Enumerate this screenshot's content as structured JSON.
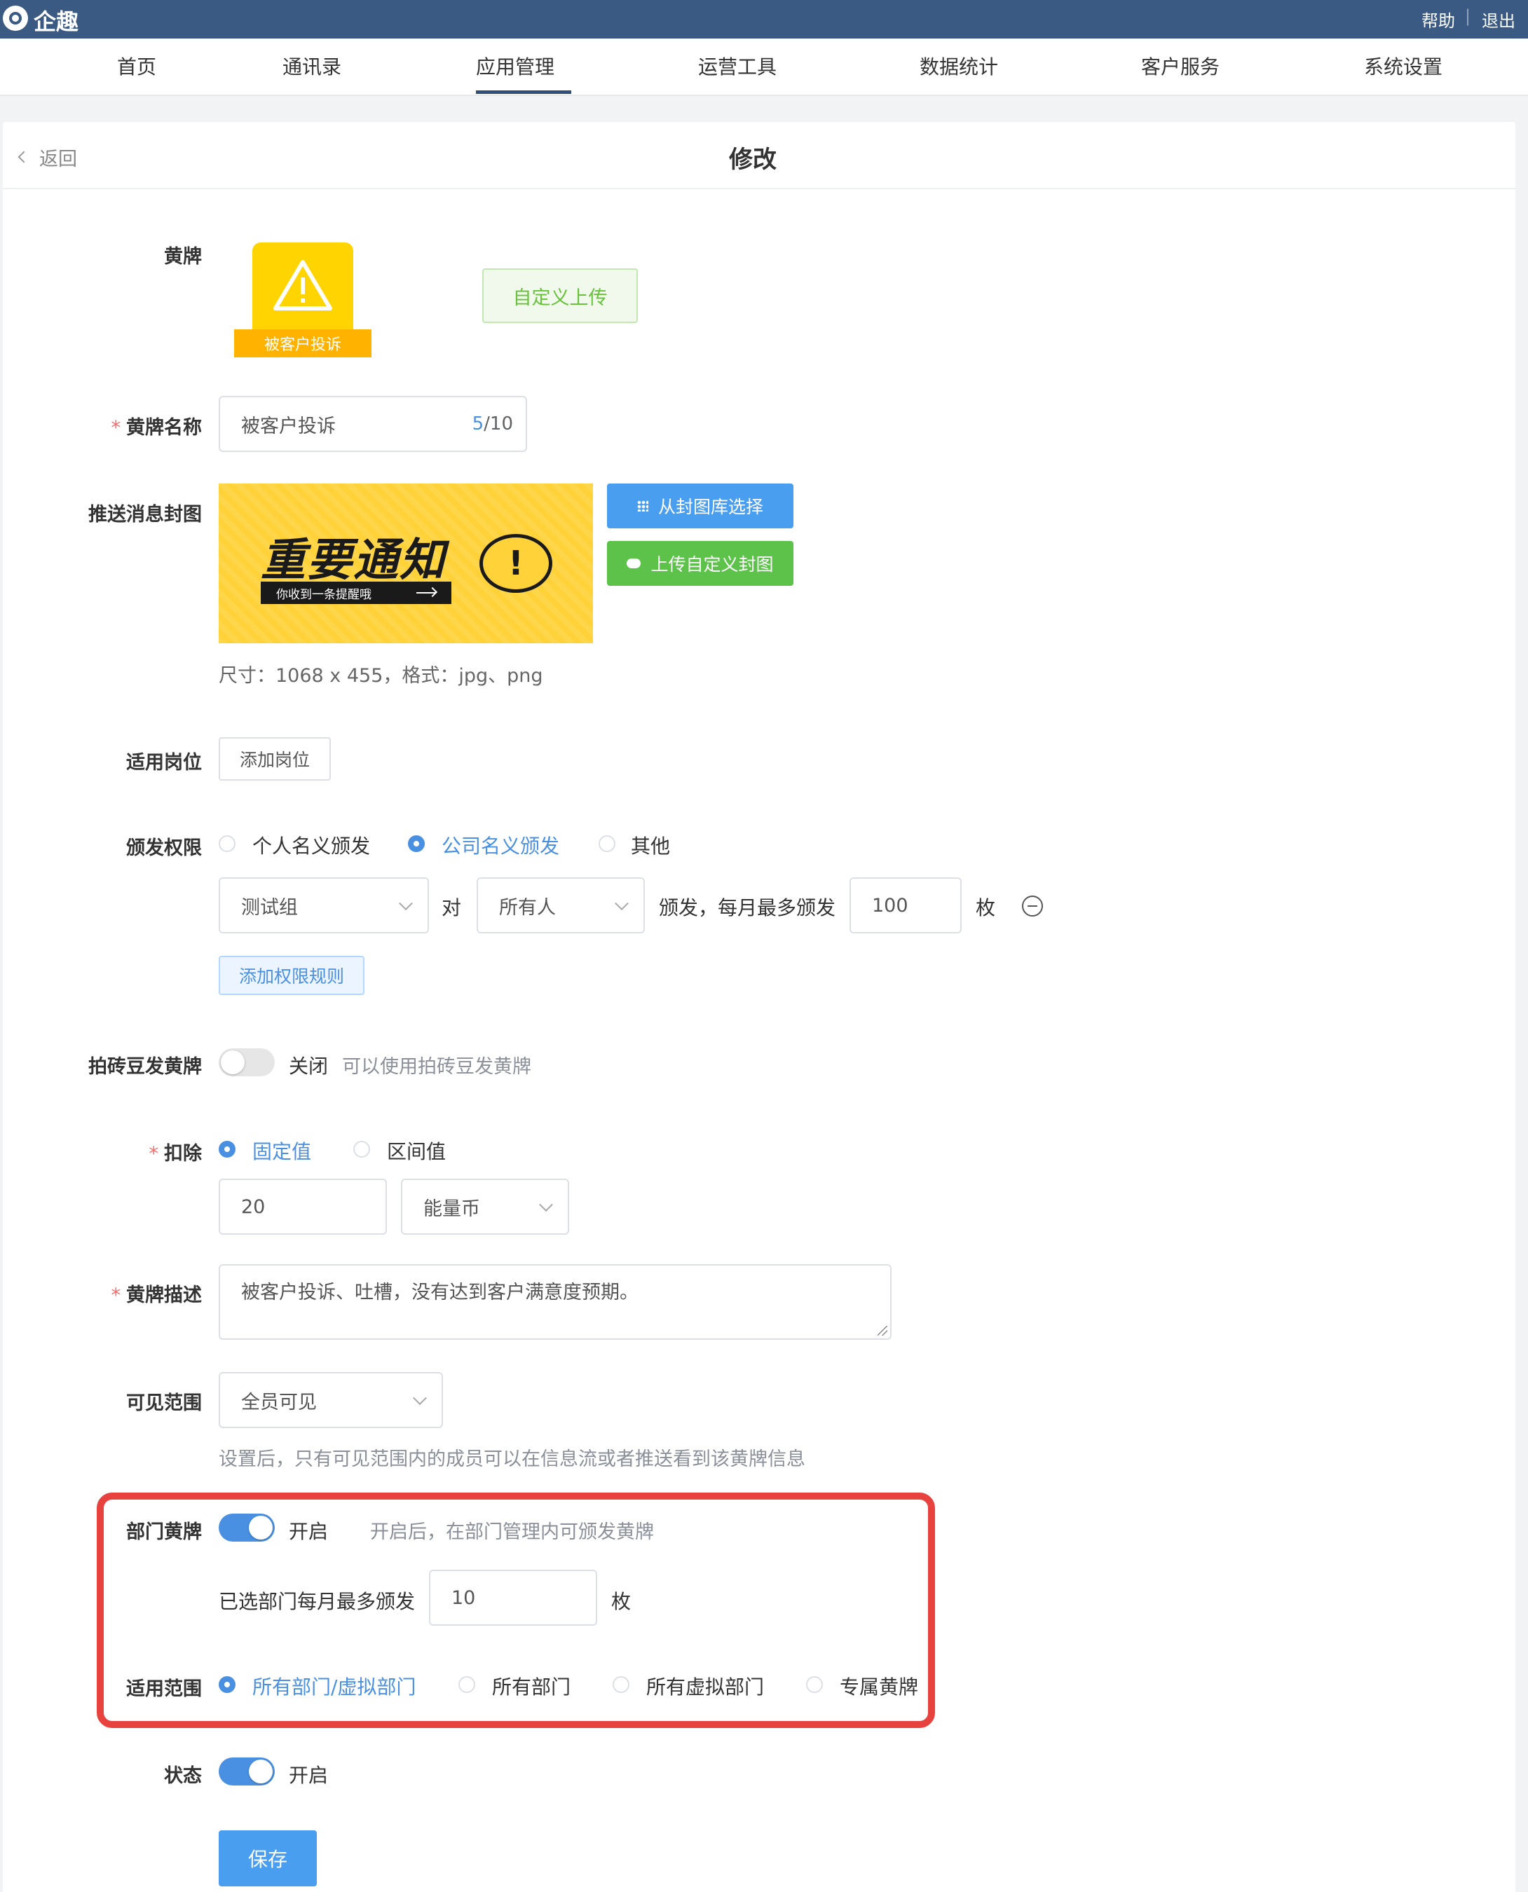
{
  "app": {
    "logo_text": "企趣",
    "help": "帮助",
    "sep": "|",
    "logout": "退出"
  },
  "nav": {
    "items": [
      "首页",
      "通讯录",
      "应用管理",
      "运营工具",
      "数据统计",
      "客户服务",
      "系统设置"
    ]
  },
  "header": {
    "back": "返回",
    "title": "修改"
  },
  "badge": {
    "label": "黄牌",
    "icon_caption": "被客户投诉",
    "upload": "自定义上传"
  },
  "name": {
    "label": "黄牌名称",
    "value": "被客户投诉",
    "count": "5",
    "max": "/10"
  },
  "cover": {
    "label": "推送消息封图",
    "headline": "重要通知",
    "subline": "你收到一条提醒哦",
    "mark": "!",
    "choose": "从封图库选择",
    "upload": "上传自定义封图",
    "hint": "尺寸：1068 x 455，格式：jpg、png"
  },
  "position": {
    "label": "适用岗位",
    "add": "添加岗位"
  },
  "permission": {
    "label": "颁发权限",
    "options": [
      "个人名义颁发",
      "公司名义颁发",
      "其他"
    ],
    "group": "测试组",
    "dui": "对",
    "target": "所有人",
    "mid": "颁发，每月最多颁发",
    "limit": "100",
    "unit": "枚",
    "add_rule": "添加权限规则"
  },
  "brick": {
    "label": "拍砖豆发黄牌",
    "state": "关闭",
    "hint": "可以使用拍砖豆发黄牌"
  },
  "deduct": {
    "label": "扣除",
    "options": [
      "固定值",
      "区间值"
    ],
    "value": "20",
    "currency": "能量币"
  },
  "desc": {
    "label": "黄牌描述",
    "value": "被客户投诉、吐槽，没有达到客户满意度预期。"
  },
  "visible": {
    "label": "可见范围",
    "value": "全员可见",
    "hint": "设置后，只有可见范围内的成员可以在信息流或者推送看到该黄牌信息"
  },
  "dept": {
    "label": "部门黄牌",
    "state": "开启",
    "hint": "开启后，在部门管理内可颁发黄牌",
    "monthly_label": "已选部门每月最多颁发",
    "monthly_value": "10",
    "unit": "枚",
    "scope_label": "适用范围",
    "scope_options": [
      "所有部门/虚拟部门",
      "所有部门",
      "所有虚拟部门",
      "专属黄牌"
    ]
  },
  "status": {
    "label": "状态",
    "state": "开启"
  },
  "save": "保存",
  "colors": {
    "primary": "#4a90e2",
    "green": "#67c23a",
    "yellow": "#ffd400",
    "orange": "#ffb300",
    "highlight": "#e8423f"
  }
}
